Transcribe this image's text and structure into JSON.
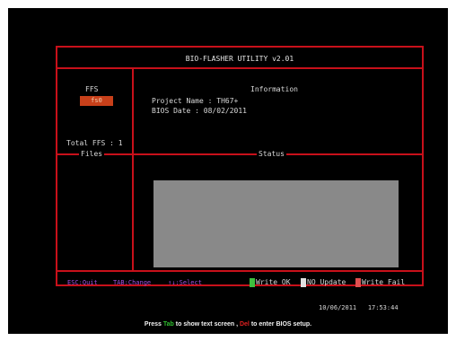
{
  "app": {
    "title": "BIO-FLASHER UTILITY v2.01"
  },
  "fs_panel": {
    "label": "FFS",
    "selected": "fs0",
    "total": "Total FFS : 1",
    "files_label": "Files"
  },
  "info": {
    "label": "Information",
    "project": "Project Name : TH67+",
    "bios_date": "BIOS Date    : 08/02/2011"
  },
  "status": {
    "label": "Status"
  },
  "keys": {
    "esc": "ESC:Quit",
    "tab": "TAB:Change",
    "select": "↑↓:Select"
  },
  "legend": {
    "write_ok": "Write OK",
    "no_update": "NO Update",
    "write_fail": "Write Fail",
    "colors": {
      "write_ok": "#3fbf3f",
      "no_update": "#e0e0e0",
      "write_fail": "#e05050"
    }
  },
  "clock": {
    "date": "10/06/2011",
    "time": "17:53:44"
  },
  "footer": {
    "press": "Press ",
    "tab_key": "Tab",
    "text1": " to show text screen , ",
    "del_key": "Del",
    "text2": " to enter BIOS setup."
  }
}
